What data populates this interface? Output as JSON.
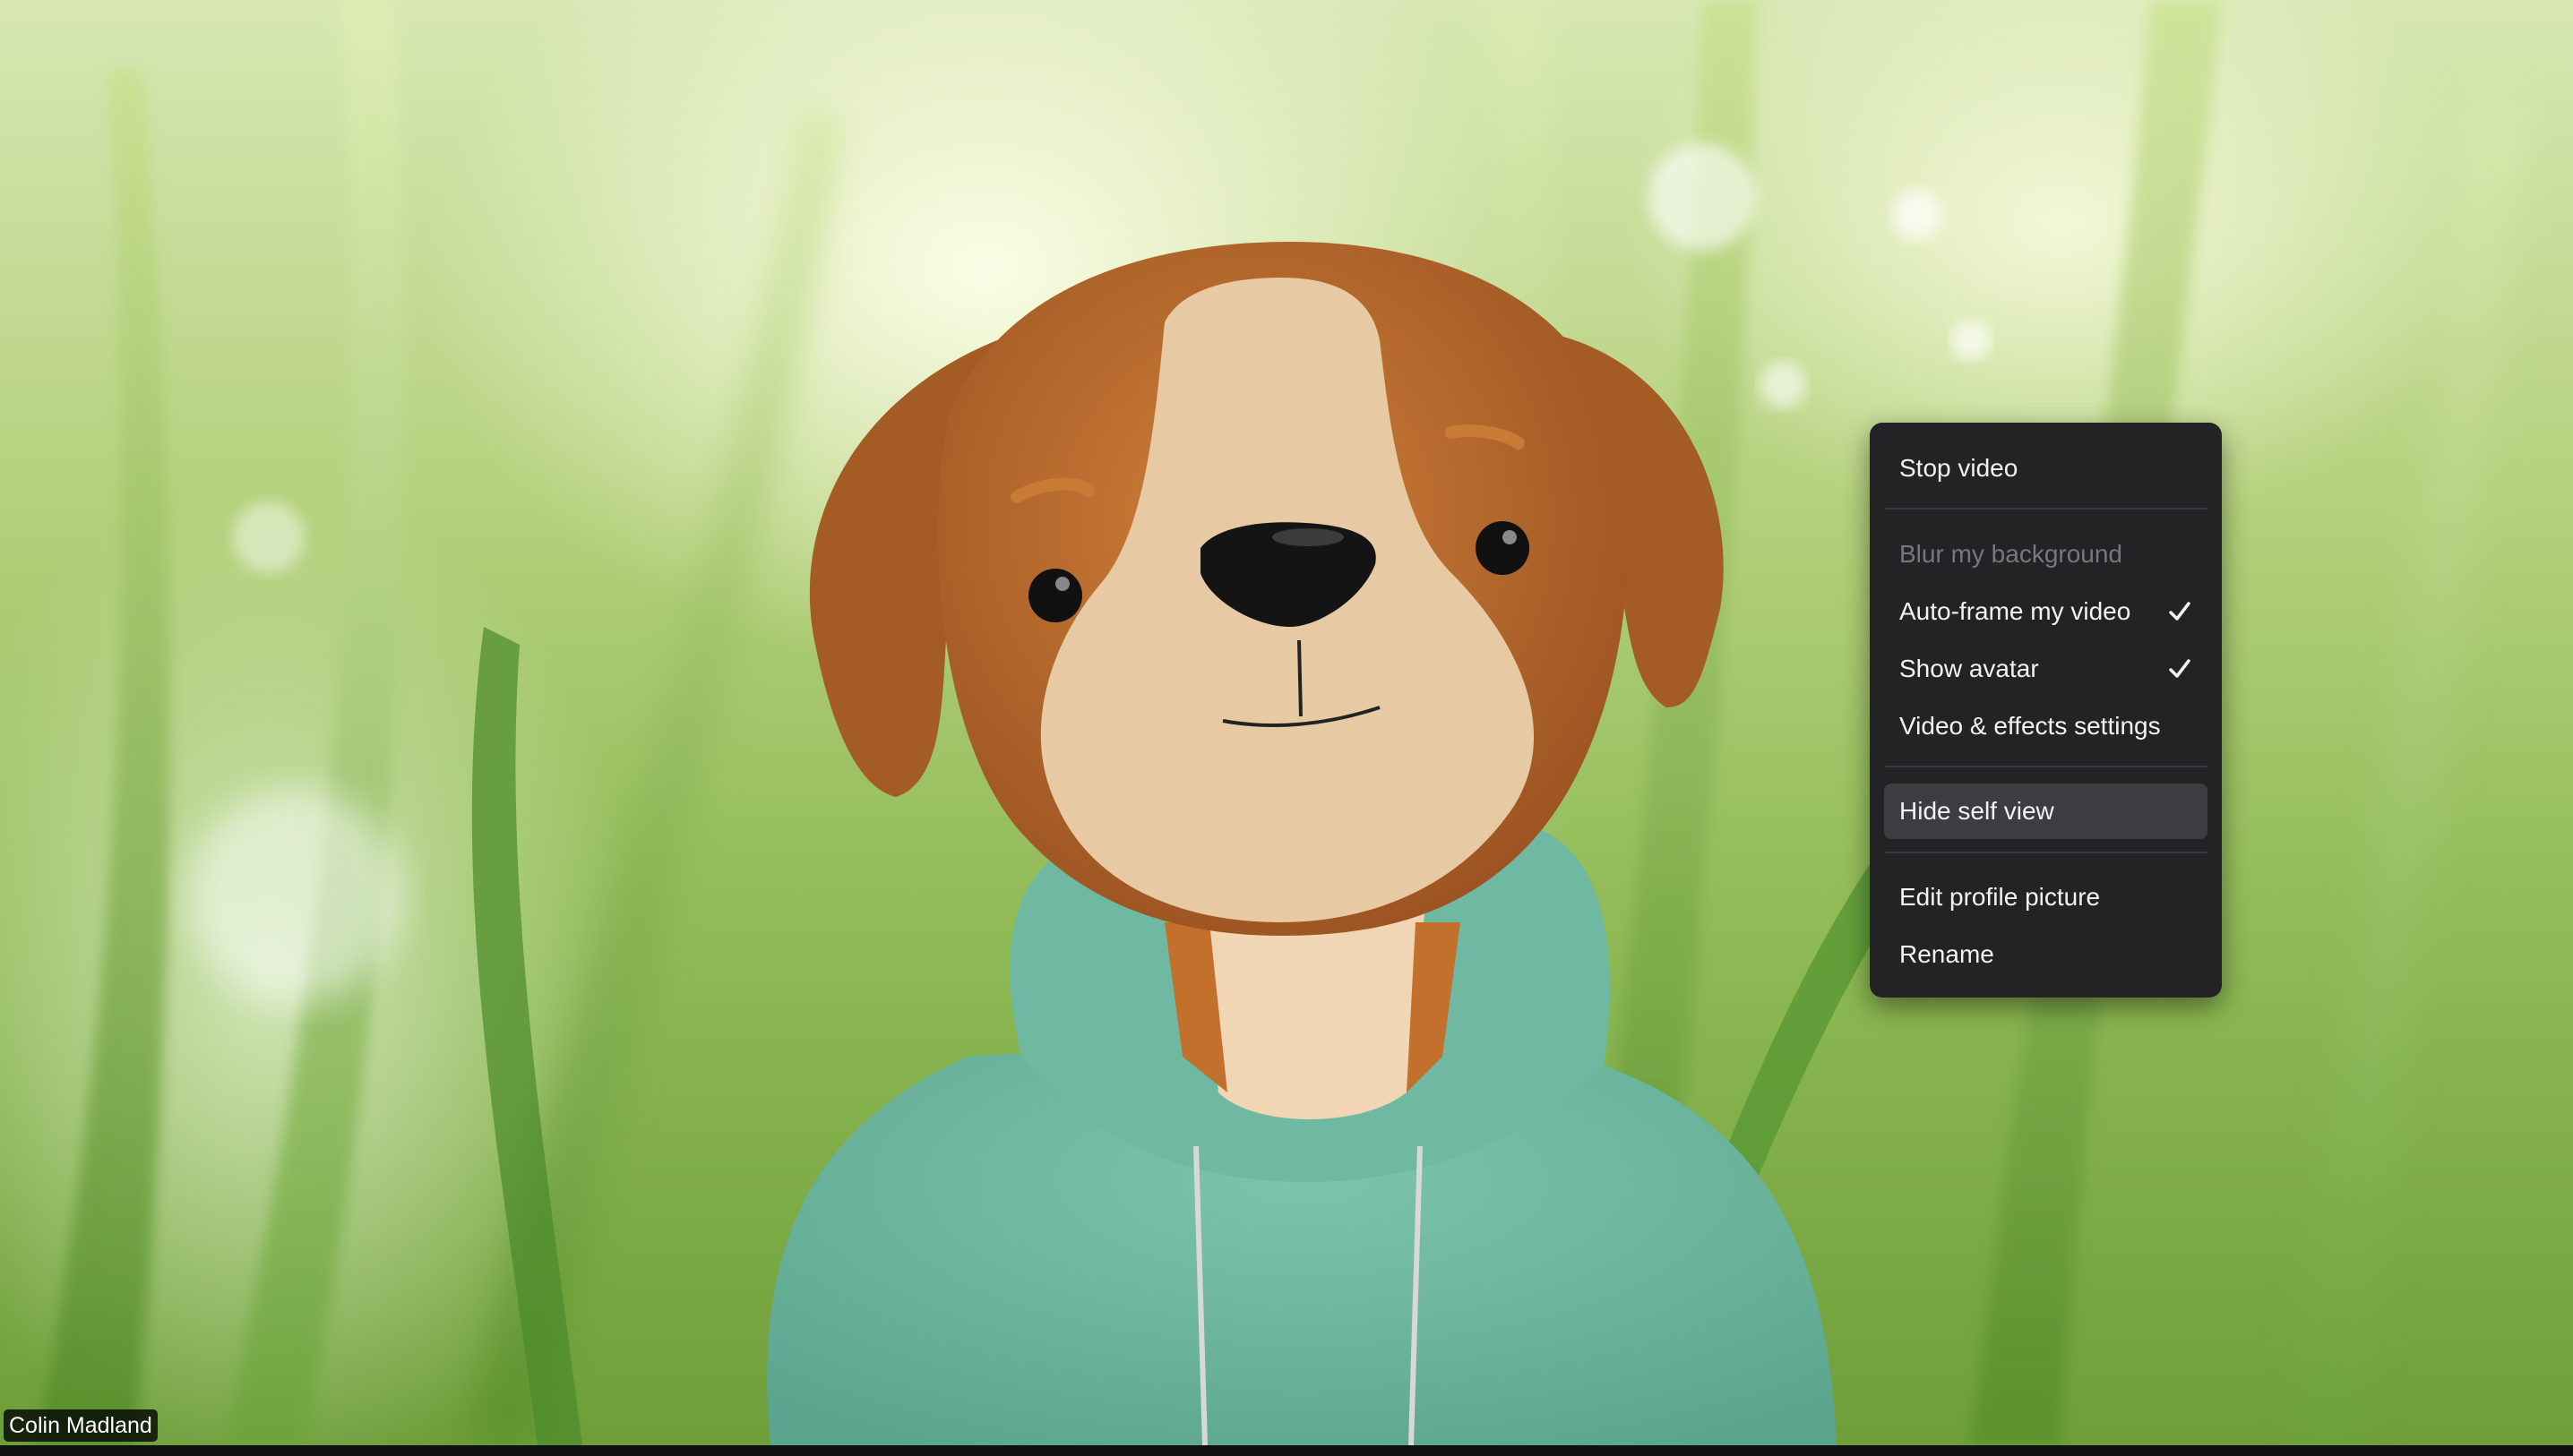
{
  "self_view": {
    "participant_name": "Colin Madland"
  },
  "context_menu": {
    "items": [
      {
        "label": "Stop video",
        "enabled": true,
        "checked": false
      },
      {
        "label": "Blur my background",
        "enabled": false,
        "checked": false
      },
      {
        "label": "Auto-frame my video",
        "enabled": true,
        "checked": true
      },
      {
        "label": "Show avatar",
        "enabled": true,
        "checked": true
      },
      {
        "label": "Video & effects settings",
        "enabled": true,
        "checked": false
      },
      {
        "label": "Hide self view",
        "enabled": true,
        "checked": false,
        "highlighted": true
      },
      {
        "label": "Edit profile picture",
        "enabled": true,
        "checked": false
      },
      {
        "label": "Rename",
        "enabled": true,
        "checked": false
      }
    ]
  },
  "icons": {
    "checkmark": "checkmark-icon"
  },
  "colors": {
    "menu_background": "#232326",
    "menu_highlight": "#3c3c41",
    "menu_text": "#f2f2f2",
    "menu_text_disabled": "#77777d",
    "hoodie": "#6ab59f",
    "dog_brown": "#b86a2a",
    "dog_cream": "#e7c9a3"
  }
}
